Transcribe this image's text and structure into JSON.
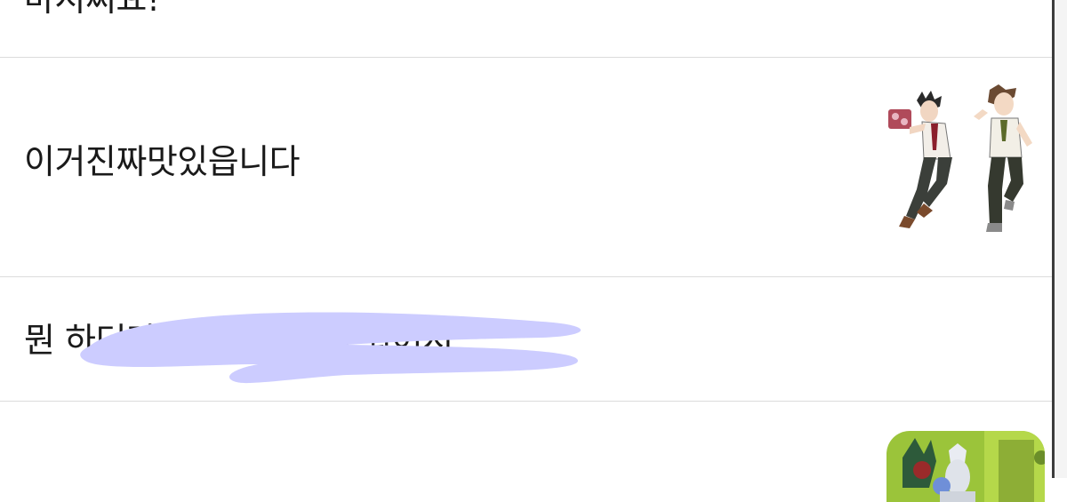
{
  "list": {
    "rows": [
      {
        "text": "마시쪄요!"
      },
      {
        "text": "이거진짜맛있읍니다",
        "thumbnail": "two-anime-characters-image"
      },
      {
        "text": "뭔 하더라도 참아보시게 되어서"
      },
      {
        "text": "",
        "thumbnail": "figurines-photo"
      }
    ]
  },
  "colors": {
    "redaction": "#ccccff",
    "divider": "#dcdcdc",
    "scrollbar_edge": "#3c3c3c"
  }
}
